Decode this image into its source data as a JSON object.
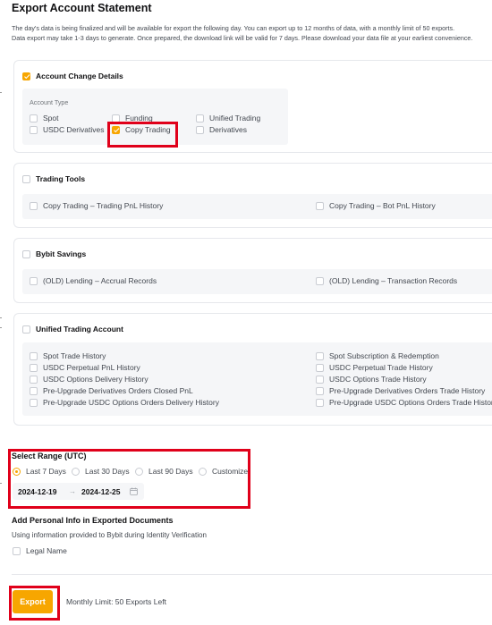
{
  "page": {
    "title": "Export Account Statement",
    "desc_line1": "The day's data is being finalized and will be available for export the following day. You can export up to 12 months of data, with a monthly limit of 50 exports.",
    "desc_line2": "Data export may take 1-3 days to generate. Once prepared, the download link will be valid for 7 days. Please download your data file at your earliest convenience."
  },
  "account_change": {
    "label": "Account Change Details",
    "checked": true,
    "type_label": "Account Type",
    "options": [
      {
        "label": "Spot",
        "checked": false
      },
      {
        "label": "Funding",
        "checked": false
      },
      {
        "label": "Unified Trading",
        "checked": false
      },
      {
        "label": "USDC Derivatives",
        "checked": false
      },
      {
        "label": "Copy Trading",
        "checked": true
      },
      {
        "label": "Derivatives",
        "checked": false
      }
    ]
  },
  "trading_tools": {
    "label": "Trading Tools",
    "options": [
      {
        "label": "Copy Trading – Trading PnL History"
      },
      {
        "label": "Copy Trading – Bot PnL History"
      }
    ]
  },
  "bybit_savings": {
    "label": "Bybit Savings",
    "options": [
      {
        "label": "(OLD) Lending – Accrual Records"
      },
      {
        "label": "(OLD) Lending – Transaction Records"
      }
    ]
  },
  "unified_trading": {
    "label": "Unified Trading Account",
    "left_options": [
      {
        "label": "Spot Trade History"
      },
      {
        "label": "USDC Perpetual PnL History"
      },
      {
        "label": "USDC Options Delivery History"
      },
      {
        "label": "Pre-Upgrade Derivatives Orders Closed PnL"
      },
      {
        "label": "Pre-Upgrade USDC Options Orders Delivery History"
      }
    ],
    "right_options": [
      {
        "label": "Spot Subscription & Redemption"
      },
      {
        "label": "USDC Perpetual Trade History"
      },
      {
        "label": "USDC Options Trade History"
      },
      {
        "label": "Pre-Upgrade Derivatives Orders Trade History"
      },
      {
        "label": "Pre-Upgrade USDC Options Orders Trade History"
      }
    ]
  },
  "range": {
    "title": "Select Range (UTC)",
    "options": [
      {
        "label": "Last 7 Days",
        "selected": true
      },
      {
        "label": "Last 30 Days",
        "selected": false
      },
      {
        "label": "Last 90 Days",
        "selected": false
      },
      {
        "label": "Customize",
        "selected": false
      }
    ],
    "start_date": "2024-12-19",
    "arrow": "→",
    "end_date": "2024-12-25"
  },
  "personal_info": {
    "title": "Add Personal Info in Exported Documents",
    "subtitle": "Using information provided to Bybit during Identity Verification",
    "legal_name": "Legal Name"
  },
  "footer": {
    "export_label": "Export",
    "limit_text": "Monthly Limit: 50 Exports Left"
  },
  "colors": {
    "accent": "#f7a600",
    "highlight_box": "#e0001a",
    "text_secondary": "#42474f"
  }
}
